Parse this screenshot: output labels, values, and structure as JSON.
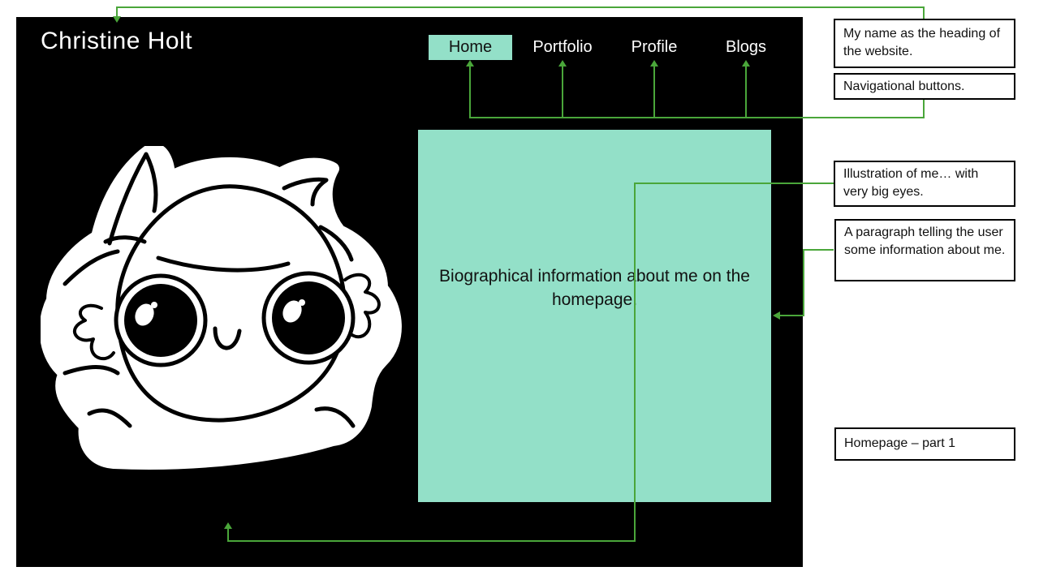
{
  "site": {
    "title": "Christine Holt",
    "nav": [
      {
        "label": "Home",
        "active": true
      },
      {
        "label": "Portfolio",
        "active": false
      },
      {
        "label": "Profile",
        "active": false
      },
      {
        "label": "Blogs",
        "active": false
      }
    ],
    "bio_text": "Biographical information about me on the homepage."
  },
  "annotations": {
    "heading_note": "My name as the heading of the website.",
    "nav_note": "Navigational buttons.",
    "illustration_note": "Illustration of me… with very big eyes.",
    "paragraph_note": "A paragraph telling the user some information about me.",
    "page_caption": "Homepage – part 1"
  },
  "colors": {
    "page_background": "#000000",
    "accent_mint": "#93e0c8",
    "connector_green": "#4aa63a"
  }
}
